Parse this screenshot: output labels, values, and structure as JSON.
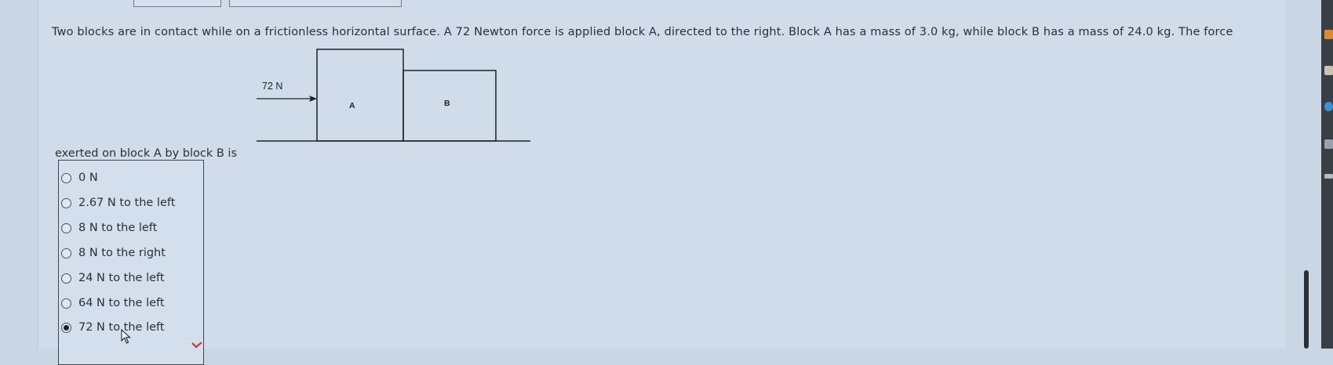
{
  "question": {
    "line1": "Two blocks are in contact while on a frictionless horizontal surface. A 72 Newton force is applied block A, directed to the right. Block A has a mass of 3.0 kg, while block B has a mass of 24.0 kg. The force",
    "line2": "exerted on block A by block B is"
  },
  "diagram": {
    "force_label": "72 N",
    "block_a_label": "A",
    "block_b_label": "B"
  },
  "options": [
    {
      "label": "0 N",
      "selected": false
    },
    {
      "label": "2.67 N to the left",
      "selected": false
    },
    {
      "label": "8 N to the left",
      "selected": false
    },
    {
      "label": "8 N to the right",
      "selected": false
    },
    {
      "label": "24 N to the left",
      "selected": false
    },
    {
      "label": "64 N to the left",
      "selected": false
    },
    {
      "label": "72 N to the left",
      "selected": true
    }
  ],
  "colors": {
    "background": "#c9d6e3",
    "text": "#2b2f36",
    "feedback_mark": "#d0342c"
  }
}
